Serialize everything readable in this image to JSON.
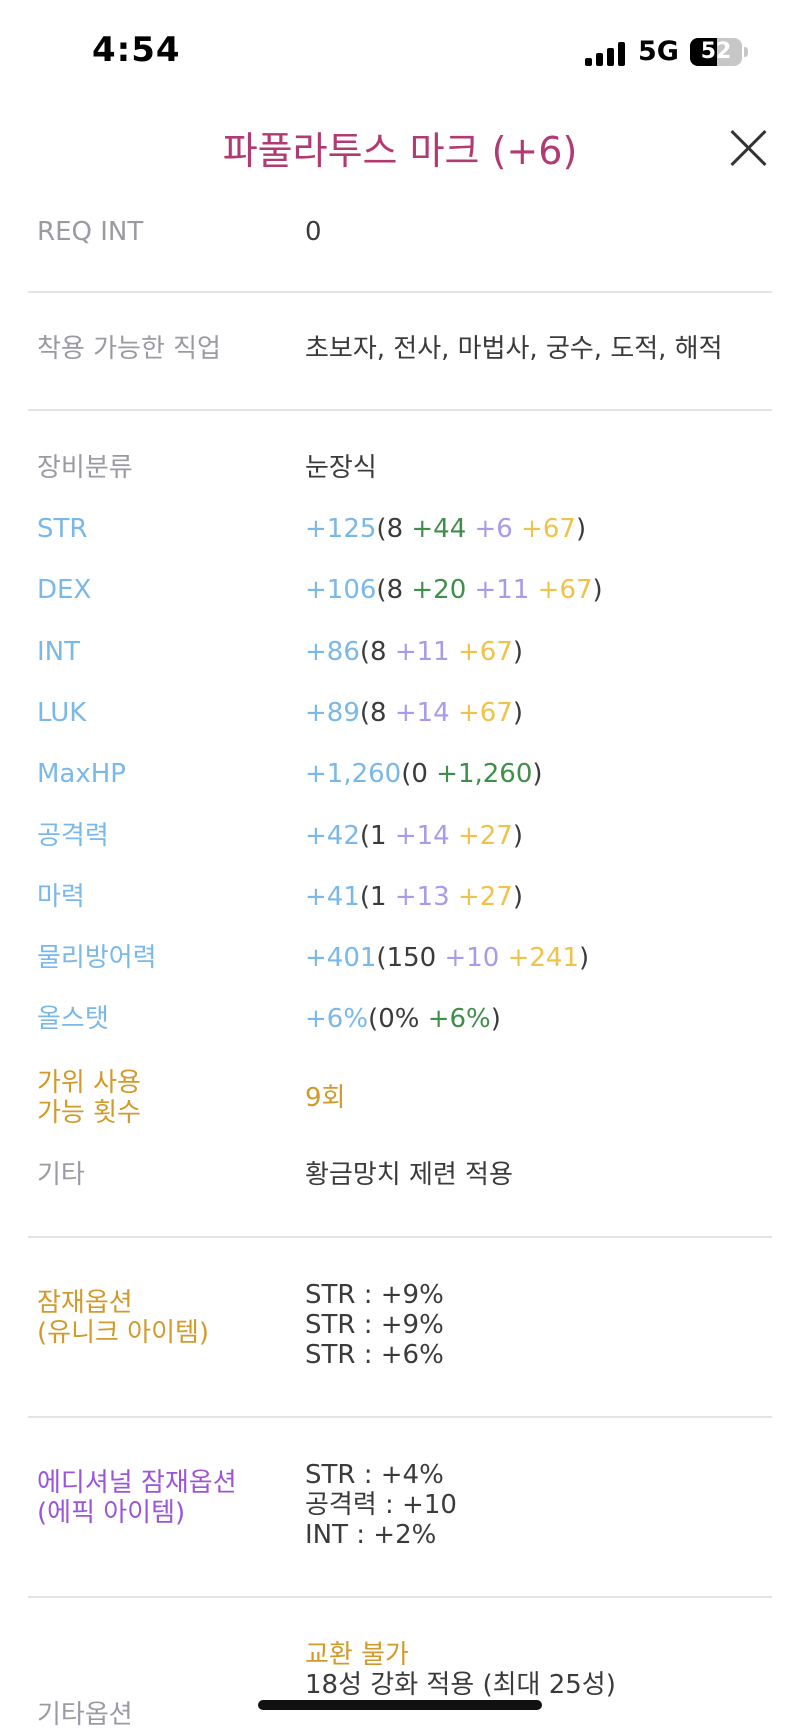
{
  "status": {
    "time": "4:54",
    "network": "5G",
    "battery": "52"
  },
  "header": {
    "title": "파풀라투스 마크 (+6)"
  },
  "req_int": {
    "label": "REQ INT",
    "value": "0"
  },
  "jobs": {
    "label": "착용 가능한 직업",
    "value": "초보자, 전사, 마법사, 궁수, 도적, 해적"
  },
  "category": {
    "label": "장비분류",
    "value": "눈장식"
  },
  "stats": [
    {
      "label": "STR",
      "total": "+125",
      "base": "(8",
      "parts": [
        {
          "v": " +44",
          "c": "s-green"
        },
        {
          "v": " +6",
          "c": "s-lav"
        },
        {
          "v": " +67",
          "c": "s-yel"
        }
      ],
      "close": ")"
    },
    {
      "label": "DEX",
      "total": "+106",
      "base": "(8",
      "parts": [
        {
          "v": " +20",
          "c": "s-green"
        },
        {
          "v": " +11",
          "c": "s-lav"
        },
        {
          "v": " +67",
          "c": "s-yel"
        }
      ],
      "close": ")"
    },
    {
      "label": "INT",
      "total": "+86",
      "base": "(8",
      "parts": [
        {
          "v": " +11",
          "c": "s-lav"
        },
        {
          "v": " +67",
          "c": "s-yel"
        }
      ],
      "close": ")"
    },
    {
      "label": "LUK",
      "total": "+89",
      "base": "(8",
      "parts": [
        {
          "v": " +14",
          "c": "s-lav"
        },
        {
          "v": " +67",
          "c": "s-yel"
        }
      ],
      "close": ")"
    },
    {
      "label": "MaxHP",
      "total": "+1,260",
      "base": "(0",
      "parts": [
        {
          "v": " +1,260",
          "c": "s-green"
        }
      ],
      "close": ")"
    },
    {
      "label": "공격력",
      "total": "+42",
      "base": "(1",
      "parts": [
        {
          "v": " +14",
          "c": "s-lav"
        },
        {
          "v": " +27",
          "c": "s-yel"
        }
      ],
      "close": ")"
    },
    {
      "label": "마력",
      "total": "+41",
      "base": "(1",
      "parts": [
        {
          "v": " +13",
          "c": "s-lav"
        },
        {
          "v": " +27",
          "c": "s-yel"
        }
      ],
      "close": ")"
    },
    {
      "label": "물리방어력",
      "total": "+401",
      "base": "(150",
      "parts": [
        {
          "v": " +10",
          "c": "s-lav"
        },
        {
          "v": " +241",
          "c": "s-yel"
        }
      ],
      "close": ")"
    },
    {
      "label": "올스탯",
      "total": "+6%",
      "base": "(0%",
      "parts": [
        {
          "v": " +6%",
          "c": "s-green"
        }
      ],
      "close": ")"
    }
  ],
  "scissors": {
    "label": "가위 사용\n가능 횟수",
    "value": "9회"
  },
  "etc": {
    "label": "기타",
    "value": "황금망치 제련 적용"
  },
  "potential": {
    "label": "잠재옵션\n(유니크 아이템)",
    "lines": [
      "STR : +9%",
      "STR : +9%",
      "STR : +6%"
    ]
  },
  "additional": {
    "label": "에디셔널 잠재옵션\n(에픽 아이템)",
    "lines": [
      "STR : +4%",
      "공격력 : +10",
      "INT : +2%"
    ]
  },
  "other_options": {
    "label": "기타옵션",
    "tradeable": "교환 불가",
    "starforce": "18성 강화 적용 (최대 25성)"
  },
  "colors": {
    "title": "#b23a72",
    "stat_label": "#7ab8ea",
    "unique": "#d19a2a",
    "epic": "#9b55d9"
  }
}
